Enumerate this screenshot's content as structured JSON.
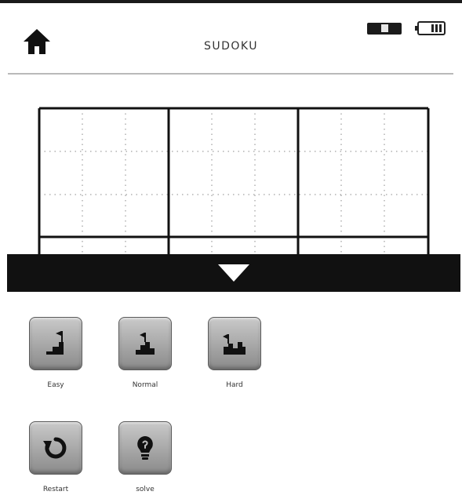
{
  "header": {
    "title": "SUDOKU",
    "home_icon": "home-icon",
    "status_icon": "status-indicator-icon",
    "battery_icon": "battery-icon"
  },
  "board": {
    "rows_visible": 3,
    "box_columns": 3
  },
  "collapse_icon": "triangle-down-icon",
  "menu": {
    "difficulty": [
      {
        "label": "Easy",
        "icon": "stairs-flag-icon"
      },
      {
        "label": "Normal",
        "icon": "stairs-flag-icon"
      },
      {
        "label": "Hard",
        "icon": "stairs-flag-icon"
      }
    ],
    "actions": [
      {
        "label": "Restart",
        "icon": "restart-icon"
      },
      {
        "label": "solve",
        "icon": "lightbulb-icon"
      }
    ]
  },
  "colors": {
    "bar": "#111111",
    "button_gradient_top": "#c9c9c9",
    "button_gradient_bottom": "#8a8a8a"
  }
}
